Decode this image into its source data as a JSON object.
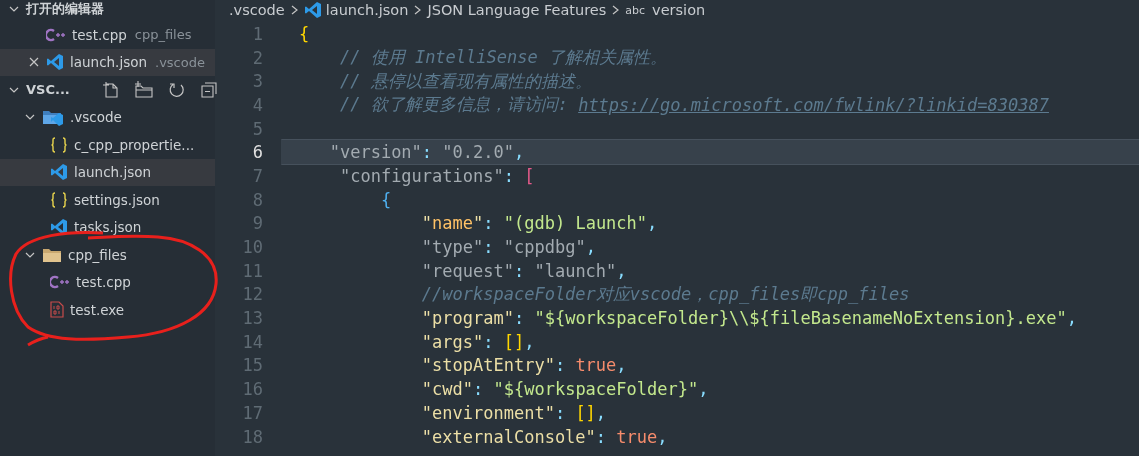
{
  "sidebar": {
    "open_editors": {
      "title": "打开的编辑器",
      "expanded": true,
      "items": [
        {
          "name": "test.cpp",
          "description": "cpp_files",
          "kind": "cpp",
          "selected": false,
          "closable": false
        },
        {
          "name": "launch.json",
          "description": ".vscode",
          "kind": "vscode",
          "selected": true,
          "closable": true
        }
      ]
    },
    "explorer": {
      "title": "VSC...",
      "expanded": true,
      "tree": [
        {
          "name": ".vscode",
          "kind": "folder-vscode",
          "expanded": true,
          "selected": false,
          "children": [
            {
              "name": "c_cpp_propertie...",
              "kind": "braces",
              "selected": false
            },
            {
              "name": "launch.json",
              "kind": "vscode",
              "selected": true
            },
            {
              "name": "settings.json",
              "kind": "braces",
              "selected": false
            },
            {
              "name": "tasks.json",
              "kind": "vscode",
              "selected": false
            }
          ]
        },
        {
          "name": "cpp_files",
          "kind": "folder",
          "expanded": true,
          "selected": false,
          "children": [
            {
              "name": "test.cpp",
              "kind": "cpp",
              "selected": false
            },
            {
              "name": "test.exe",
              "kind": "binary",
              "selected": false
            }
          ]
        }
      ]
    }
  },
  "breadcrumb": [
    {
      "label": ".vscode"
    },
    {
      "label": "launch.json",
      "kind": "vscode"
    },
    {
      "label": "JSON Language Features"
    },
    {
      "label": "version",
      "symbol": "abc"
    }
  ],
  "editor": {
    "lines": [
      {
        "number": "1",
        "current": false,
        "tokens": [
          {
            "kind": "bracket-gold",
            "text": "{"
          }
        ]
      },
      {
        "number": "2",
        "current": false,
        "tokens": [
          {
            "kind": "comment",
            "text": "    // 使用 IntelliSense 了解相关属性。"
          }
        ]
      },
      {
        "number": "3",
        "current": false,
        "tokens": [
          {
            "kind": "comment",
            "text": "    // 悬停以查看现有属性的描述。"
          }
        ]
      },
      {
        "number": "4",
        "current": false,
        "tokens": [
          {
            "kind": "comment",
            "text": "    // 欲了解更多信息，请访问: "
          },
          {
            "kind": "link",
            "text": "https://go.microsoft.com/fwlink/?linkid=830387"
          }
        ]
      },
      {
        "number": "5",
        "current": false
      },
      {
        "number": "6",
        "current": true,
        "tokens": [
          {
            "kind": "dim",
            "text": "   \"version\""
          },
          {
            "kind": "punct",
            "text": ": "
          },
          {
            "kind": "dim",
            "text": "\"0.2.0\""
          },
          {
            "kind": "punct",
            "text": ","
          }
        ]
      },
      {
        "number": "7",
        "current": false,
        "tokens": [
          {
            "kind": "dim",
            "text": "    \"configurations\""
          },
          {
            "kind": "punct",
            "text": ": "
          },
          {
            "kind": "bracket-pink",
            "text": "["
          }
        ]
      },
      {
        "number": "8",
        "current": false,
        "tokens": [
          {
            "kind": "bracket-blue",
            "text": "        {"
          }
        ]
      },
      {
        "number": "9",
        "current": false,
        "tokens": [
          {
            "kind": "key",
            "text": "            \""
          },
          {
            "kind": "key-active",
            "text": "name"
          },
          {
            "kind": "key",
            "text": "\""
          },
          {
            "kind": "punct",
            "text": ": "
          },
          {
            "kind": "string",
            "text": "\"(gdb) Launch\""
          },
          {
            "kind": "punct",
            "text": ","
          }
        ]
      },
      {
        "number": "10",
        "current": false,
        "tokens": [
          {
            "kind": "dim",
            "text": "            \"type\""
          },
          {
            "kind": "punct",
            "text": ": "
          },
          {
            "kind": "dim",
            "text": "\"cppdbg\""
          },
          {
            "kind": "punct",
            "text": ","
          }
        ]
      },
      {
        "number": "11",
        "current": false,
        "tokens": [
          {
            "kind": "dim",
            "text": "            \"request\""
          },
          {
            "kind": "punct",
            "text": ": "
          },
          {
            "kind": "dim",
            "text": "\"launch\""
          },
          {
            "kind": "punct",
            "text": ","
          }
        ]
      },
      {
        "number": "12",
        "current": false,
        "tokens": [
          {
            "kind": "comment",
            "text": "            //workspaceFolder对应vscode，cpp_files即cpp_files"
          }
        ]
      },
      {
        "number": "13",
        "current": false,
        "tokens": [
          {
            "kind": "key",
            "text": "            \"program\""
          },
          {
            "kind": "punct",
            "text": ": "
          },
          {
            "kind": "string",
            "text": "\"${workspaceFolder}\\\\${fileBasenameNoExtension}.exe\""
          },
          {
            "kind": "punct",
            "text": ","
          }
        ]
      },
      {
        "number": "14",
        "current": false,
        "tokens": [
          {
            "kind": "key",
            "text": "            \"args\""
          },
          {
            "kind": "punct",
            "text": ": "
          },
          {
            "kind": "bracket-gold",
            "text": "[]"
          },
          {
            "kind": "punct",
            "text": ","
          }
        ]
      },
      {
        "number": "15",
        "current": false,
        "tokens": [
          {
            "kind": "key",
            "text": "            \"stopAtEntry\""
          },
          {
            "kind": "punct",
            "text": ": "
          },
          {
            "kind": "bool",
            "text": "true"
          },
          {
            "kind": "punct",
            "text": ","
          }
        ]
      },
      {
        "number": "16",
        "current": false,
        "tokens": [
          {
            "kind": "key",
            "text": "            \"cwd\""
          },
          {
            "kind": "punct",
            "text": ": "
          },
          {
            "kind": "string",
            "text": "\"${workspaceFolder}\""
          },
          {
            "kind": "punct",
            "text": ","
          }
        ]
      },
      {
        "number": "17",
        "current": false,
        "tokens": [
          {
            "kind": "key",
            "text": "            \"environment\""
          },
          {
            "kind": "punct",
            "text": ": "
          },
          {
            "kind": "bracket-gold",
            "text": "[]"
          },
          {
            "kind": "punct",
            "text": ","
          }
        ]
      },
      {
        "number": "18",
        "current": false,
        "tokens": [
          {
            "kind": "key",
            "text": "            \"externalConsole\""
          },
          {
            "kind": "punct",
            "text": ": "
          },
          {
            "kind": "bool",
            "text": "true"
          },
          {
            "kind": "punct",
            "text": ","
          }
        ]
      }
    ]
  }
}
